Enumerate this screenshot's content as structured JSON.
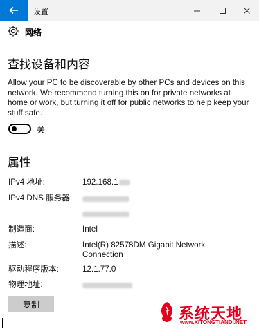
{
  "window": {
    "title": "设置",
    "accent": "#0078d7"
  },
  "header": {
    "title": "网络"
  },
  "discovery": {
    "heading": "查找设备和内容",
    "description": "Allow your PC to be discoverable by other PCs and devices on this network. We recommend turning this on for private networks at home or work, but turning it off for public networks to help keep your stuff safe.",
    "toggle_state": "关",
    "toggle_on": false
  },
  "properties": {
    "heading": "属性",
    "rows": [
      {
        "label": "IPv4 地址:",
        "value": "192.168.1"
      },
      {
        "label": "IPv4 DNS 服务器:",
        "value": ""
      },
      {
        "label": "制造商:",
        "value": "Intel"
      },
      {
        "label": "描述:",
        "value": "Intel(R) 82578DM Gigabit Network Connection"
      },
      {
        "label": "驱动程序版本:",
        "value": "12.1.77.0"
      },
      {
        "label": "物理地址:",
        "value": ""
      }
    ],
    "copy_label": "复制"
  },
  "watermark": {
    "name": "系统天地",
    "url": "www.XITONGTIANDI.NET",
    "color": "#e0001a"
  }
}
